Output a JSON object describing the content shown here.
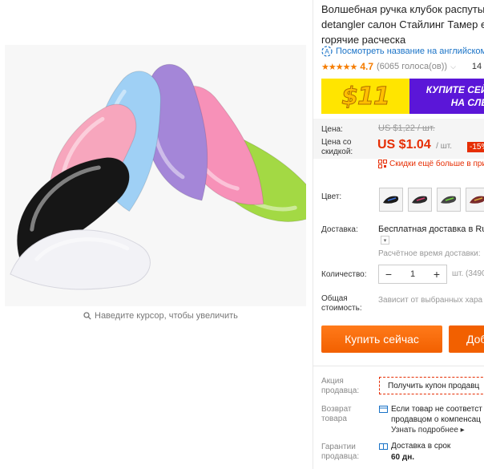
{
  "gallery": {
    "zoom_hint": "Наведите курсор, чтобы увеличить",
    "brush_colors": [
      "#f2f2f6",
      "#161616",
      "#f7a6bd",
      "#9fd0f5",
      "#a486d8",
      "#f791b8",
      "#a3d944"
    ]
  },
  "product": {
    "title_lines": [
      "Волшебная ручка клубок распутыв",
      "detangler салон Стайлинг Тамер ex",
      "горячие расческа"
    ],
    "translate_link": "Посмотреть название на английском",
    "rating_stars": "★★★★★",
    "rating_value": "4.7",
    "votes": "(6065 голоса(ов))",
    "orders_prefix": "14"
  },
  "promo": {
    "price": "$11",
    "text_line1": "КУПИТЕ СЕЙЧ",
    "text_line2": "НА СЛЕД"
  },
  "price": {
    "label_price": "Цена:",
    "old_price": "US $1,22 / шт.",
    "label_discount_line1": "Цена со",
    "label_discount_line2": "скидкой:",
    "new_price": "US $1.04",
    "unit": "/ шт.",
    "discount_badge": "-15%",
    "coupon_link": "Скидки ещё больше в при"
  },
  "options": {
    "color_label": "Цвет:",
    "swatch_colors": [
      "#1a1a1a",
      "#2b2b2b",
      "#444444",
      "#7a2a2a"
    ],
    "delivery_label": "Доставка:",
    "delivery_text": "Бесплатная доставка в Ru",
    "delivery_time": "Расчётное время доставки:",
    "qty_label": "Количество:",
    "qty_minus": "−",
    "qty_value": "1",
    "qty_plus": "+",
    "qty_units": "шт. (3490",
    "total_label_line1": "Общая",
    "total_label_line2": "стоимость:",
    "total_text": "Зависит от выбранных хара"
  },
  "actions": {
    "buy_now": "Купить сейчас",
    "add_to_cart": "Доб"
  },
  "seller": {
    "promo_label_line1": "Акция",
    "promo_label_line2": "продавца:",
    "coupon_button": "Получить купон продавц",
    "return_label_line1": "Возврат",
    "return_label_line2": "товара",
    "return_text_line1": "Если товар не соответст",
    "return_text_line2": "продавцом о компенсац",
    "return_more": "Узнать подробнее ▸",
    "guarantee_label_line1": "Гарантии",
    "guarantee_label_line2": "продавца:",
    "guarantee_text_line1": "Доставка в срок",
    "guarantee_text_line2": "60 дн."
  }
}
